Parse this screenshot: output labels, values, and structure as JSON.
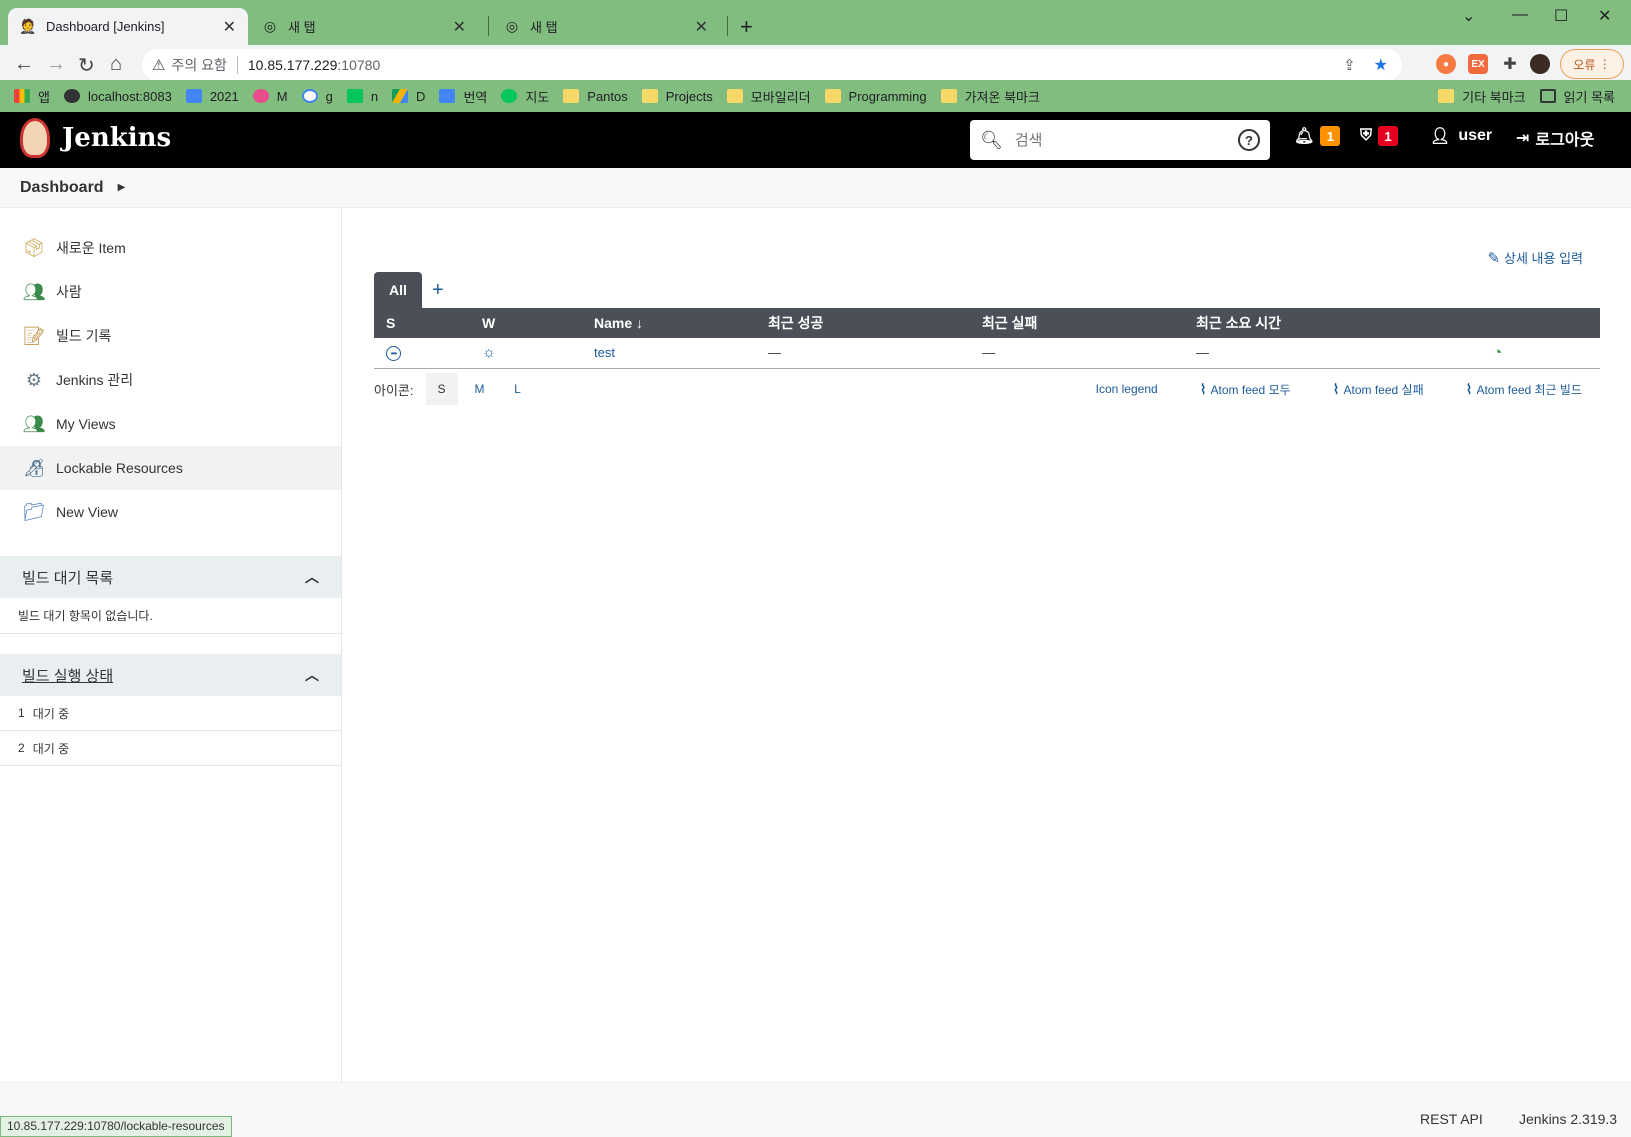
{
  "browser": {
    "tabs": [
      {
        "title": "Dashboard [Jenkins]"
      },
      {
        "title": "새 탭"
      },
      {
        "title": "새 탭"
      }
    ],
    "security_text": "주의 요함",
    "url_host": "10.85.177.229",
    "url_port": ":10780",
    "error_button": "오류",
    "bookmarks": [
      "앱",
      "localhost:8083",
      "2021",
      "M",
      "g",
      "n",
      "D",
      "번역",
      "지도",
      "Pantos",
      "Projects",
      "모바일리더",
      "Programming",
      "가져온 북마크"
    ],
    "other_bookmarks": "기타 북마크",
    "reading_list": "읽기 목록",
    "status_url": "10.85.177.229:10780/lockable-resources"
  },
  "header": {
    "brand": "Jenkins",
    "search_placeholder": "검색",
    "notifications_count": "1",
    "security_count": "1",
    "user": "user",
    "logout": "로그아웃",
    "colors": {
      "notif": "#fe9200",
      "security": "#e6001f"
    }
  },
  "breadcrumb": {
    "item": "Dashboard"
  },
  "sidebar": {
    "tasks": [
      {
        "label": "새로운 Item",
        "icon": "new-item-icon"
      },
      {
        "label": "사람",
        "icon": "people-icon"
      },
      {
        "label": "빌드 기록",
        "icon": "build-history-icon"
      },
      {
        "label": "Jenkins 관리",
        "icon": "gear-icon"
      },
      {
        "label": "My Views",
        "icon": "people-icon"
      },
      {
        "label": "Lockable Resources",
        "icon": "lock-resource-icon"
      },
      {
        "label": "New View",
        "icon": "folder-icon"
      }
    ],
    "queue": {
      "title": "빌드 대기 목록",
      "empty": "빌드 대기 항목이 없습니다."
    },
    "executors": {
      "title": "빌드 실행 상태",
      "rows": [
        {
          "num": "1",
          "status": "대기 중"
        },
        {
          "num": "2",
          "status": "대기 중"
        }
      ]
    }
  },
  "main": {
    "edit_description": "상세 내용 입력",
    "tab_all": "All",
    "columns": [
      "S",
      "W",
      "Name ↓",
      "최근 성공",
      "최근 실패",
      "최근 소요 시간"
    ],
    "jobs": [
      {
        "name": "test",
        "last_success": "—",
        "last_failure": "—",
        "last_duration": "—"
      }
    ],
    "icon_label": "아이콘:",
    "sizes": [
      "S",
      "M",
      "L"
    ],
    "icon_legend": "Icon legend",
    "feeds": [
      "Atom feed 모두",
      "Atom feed 실패",
      "Atom feed 최근 빌드"
    ]
  },
  "footer": {
    "rest_api": "REST API",
    "version": "Jenkins 2.319.3"
  }
}
